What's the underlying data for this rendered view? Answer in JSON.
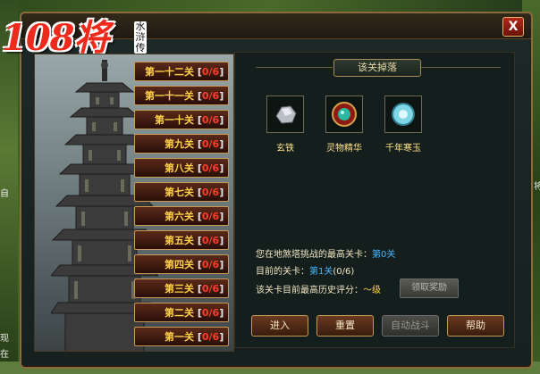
{
  "window": {
    "close_label": "X"
  },
  "logo": {
    "main": "108将",
    "sub": "水浒传"
  },
  "levels": [
    {
      "name": "第一十二关",
      "progress": "0/6"
    },
    {
      "name": "第一十一关",
      "progress": "0/6"
    },
    {
      "name": "第一十关",
      "progress": "0/6"
    },
    {
      "name": "第九关",
      "progress": "0/6"
    },
    {
      "name": "第八关",
      "progress": "0/6"
    },
    {
      "name": "第七关",
      "progress": "0/6"
    },
    {
      "name": "第六关",
      "progress": "0/6"
    },
    {
      "name": "第五关",
      "progress": "0/6"
    },
    {
      "name": "第四关",
      "progress": "0/6"
    },
    {
      "name": "第三关",
      "progress": "0/6"
    },
    {
      "name": "第二关",
      "progress": "0/6"
    },
    {
      "name": "第一关",
      "progress": "0/6"
    }
  ],
  "drops": {
    "title": "该关掉落",
    "items": [
      {
        "label": "玄铁",
        "icon": "ore-icon"
      },
      {
        "label": "灵物精华",
        "icon": "essence-icon"
      },
      {
        "label": "千年寒玉",
        "icon": "jade-icon"
      }
    ]
  },
  "info": {
    "highest_label": "您在地煞塔挑战的最高关卡：",
    "highest_value": "第0关",
    "current_label": "目前的关卡：",
    "current_value": "第1关",
    "current_progress": "(0/6)",
    "score_label": "该关卡目前最高历史评分：",
    "score_value": "～级"
  },
  "buttons": {
    "claim": "领取奖励",
    "enter": "进入",
    "reset": "重置",
    "auto": "自动战斗",
    "help": "帮助"
  },
  "background": {
    "left_text_1": "自",
    "left_text_2": "现",
    "left_text_3": "在",
    "right_text": "将"
  }
}
